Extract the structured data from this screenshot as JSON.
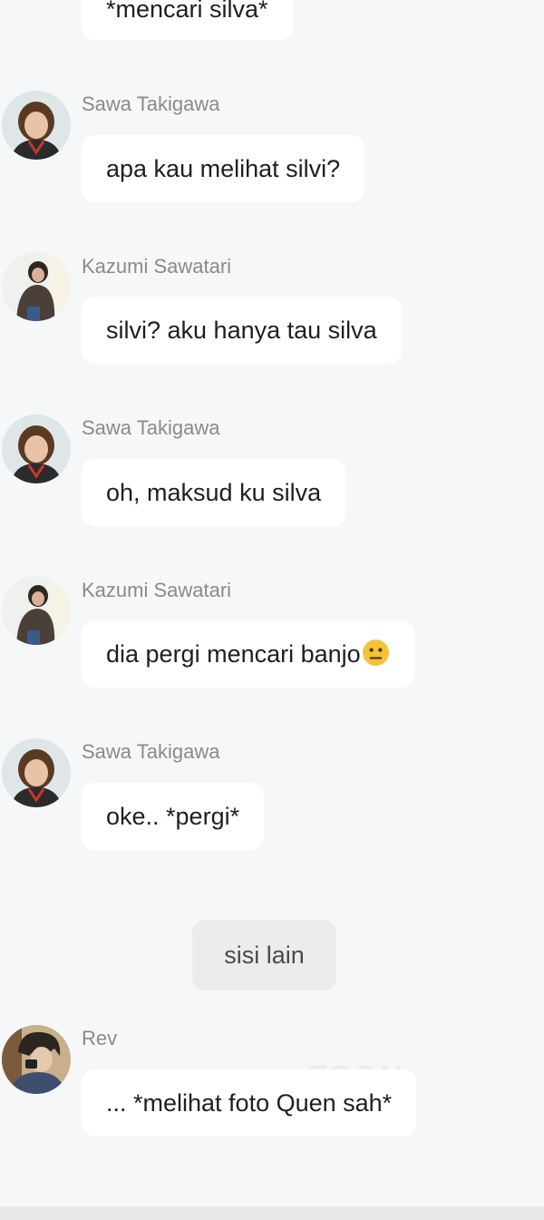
{
  "chat": {
    "top_message": "*mencari silva*",
    "messages": [
      {
        "sender": "Sawa Takigawa",
        "text": "apa kau melihat silvi?"
      },
      {
        "sender": "Kazumi Sawatari",
        "text": "silvi? aku hanya tau silva"
      },
      {
        "sender": "Sawa Takigawa",
        "text": "oh, maksud ku silva"
      },
      {
        "sender": "Kazumi Sawatari",
        "text": "dia pergi mencari banjo"
      },
      {
        "sender": "Sawa Takigawa",
        "text": "oke.. *pergi*"
      }
    ],
    "narration": "sisi lain",
    "last_message": {
      "sender": "Rev",
      "text": "... *melihat foto Quen sah*"
    }
  },
  "watermark": "TOON",
  "icons": {
    "emoji": "neutral-face-emoji",
    "avatar_sawa": "avatar-sawa-takigawa",
    "avatar_kazumi": "avatar-kazumi-sawatari",
    "avatar_rev": "avatar-rev"
  },
  "colors": {
    "background": "#f6f7f9",
    "bubble": "#ffffff",
    "narration_bubble": "#ececec",
    "sender_text": "#8a8a8a"
  }
}
